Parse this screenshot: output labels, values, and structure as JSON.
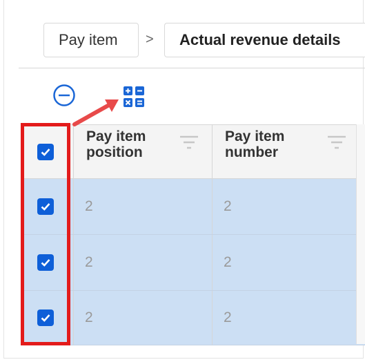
{
  "breadcrumb": {
    "items": [
      "Pay item",
      "Actual revenue details"
    ],
    "separator": ">"
  },
  "toolbar": {
    "collapse_icon": "minus-circle-icon",
    "grid_icon": "grid-calculator-icon"
  },
  "table": {
    "columns": [
      "Pay item position",
      "Pay item number"
    ],
    "rows": [
      {
        "checked": true,
        "position": "2",
        "number": "2"
      },
      {
        "checked": true,
        "position": "2",
        "number": "2"
      },
      {
        "checked": true,
        "position": "2",
        "number": "2"
      }
    ],
    "header_checked": true
  },
  "colors": {
    "accent": "#0e5fd8",
    "selected_row": "#ccdff4",
    "annotation": "#e31b1b"
  }
}
